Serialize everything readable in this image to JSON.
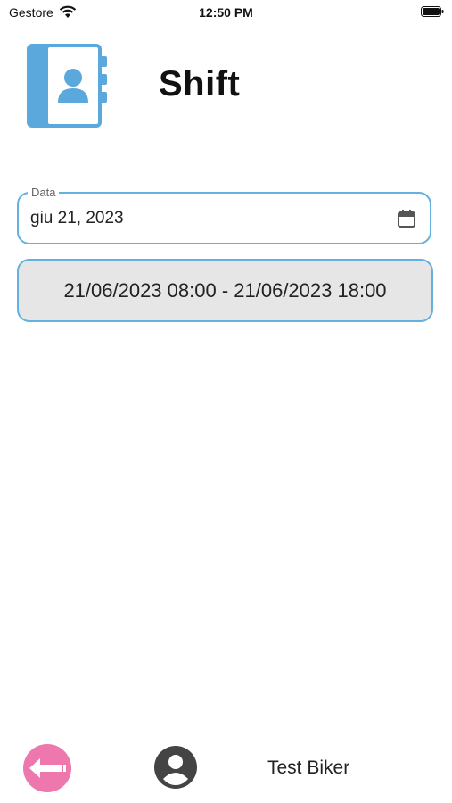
{
  "status_bar": {
    "carrier": "Gestore",
    "time": "12:50 PM"
  },
  "header": {
    "title": "Shift",
    "icon": "contact-book-icon"
  },
  "date_field": {
    "label": "Data",
    "value": "giu 21, 2023",
    "icon": "calendar-icon"
  },
  "shifts": [
    {
      "range": "21/06/2023 08:00 - 21/06/2023 18:00"
    }
  ],
  "footer": {
    "back_icon": "back-arrow-icon",
    "avatar_icon": "account-circle-icon",
    "user_name": "Test Biker"
  },
  "colors": {
    "accent": "#62b1e0",
    "icon_blue": "#5aa8dc",
    "back_button": "#ee78ad",
    "shift_bg": "#e6e6e6",
    "avatar": "#444444"
  }
}
